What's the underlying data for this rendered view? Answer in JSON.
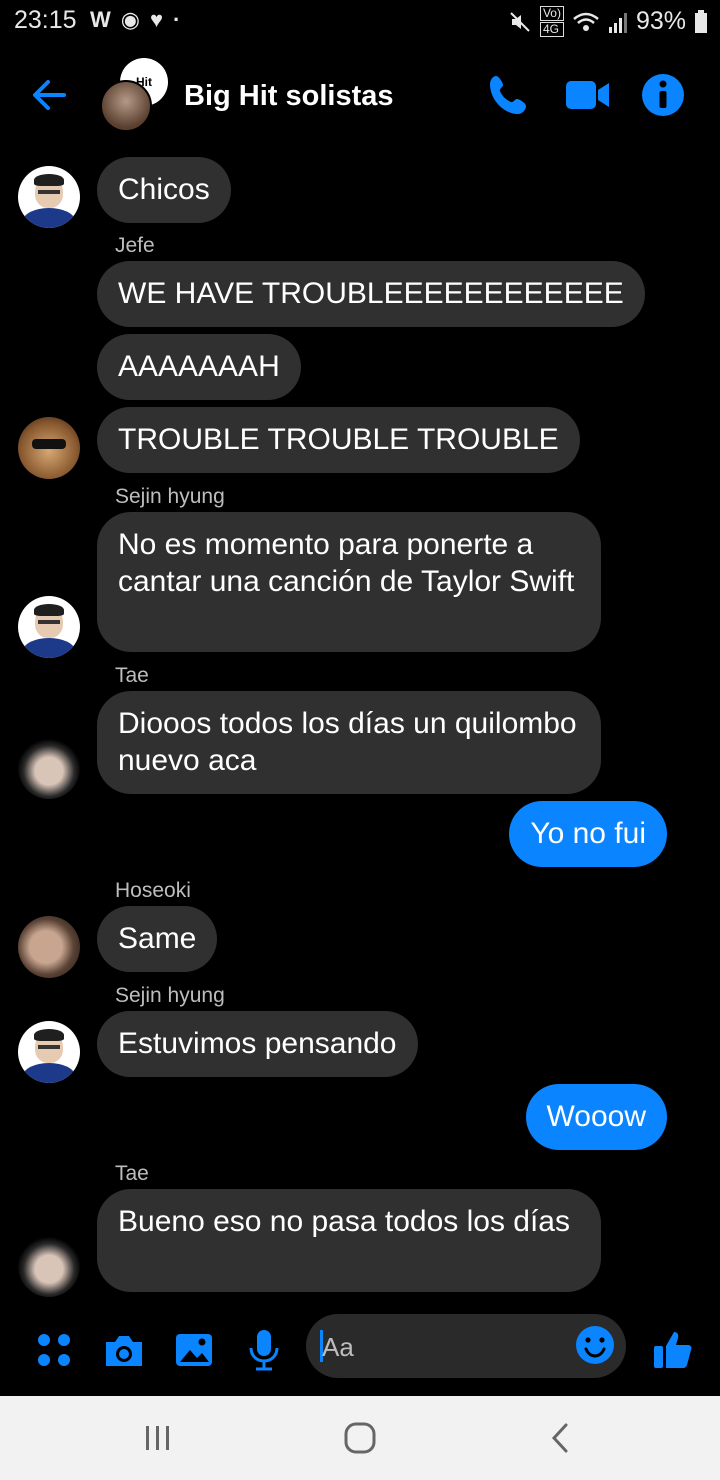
{
  "status_bar": {
    "time": "23:15",
    "left_icons": [
      "W",
      "◉",
      "♥",
      "·"
    ],
    "net_badge_1": "Vo)",
    "net_badge_2": "4G",
    "battery": "93%"
  },
  "header": {
    "title": "Big Hit solistas",
    "group_logo_text": "Hit"
  },
  "colors": {
    "accent": "#0a84ff",
    "bubble_other": "#303030",
    "background": "#000000"
  },
  "messages": [
    {
      "type": "other",
      "text": "Chicos"
    },
    {
      "type": "sender",
      "name": "Jefe"
    },
    {
      "type": "other",
      "text": "WE HAVE TROUBLEEEEEEEEEEEE"
    },
    {
      "type": "other",
      "text": "AAAAAAAH"
    },
    {
      "type": "other",
      "text": "TROUBLE TROUBLE TROUBLE"
    },
    {
      "type": "sender",
      "name": "Sejin hyung"
    },
    {
      "type": "other",
      "text": "No es momento para ponerte a cantar una canción de Taylor Swift"
    },
    {
      "type": "sender",
      "name": "Tae"
    },
    {
      "type": "other",
      "text": "Diooos todos los días un quilombo nuevo aca"
    },
    {
      "type": "mine",
      "text": "Yo no fui"
    },
    {
      "type": "sender",
      "name": "Hoseoki"
    },
    {
      "type": "other",
      "text": "Same"
    },
    {
      "type": "sender",
      "name": "Sejin hyung"
    },
    {
      "type": "other",
      "text": "Estuvimos pensando"
    },
    {
      "type": "mine",
      "text": "Wooow"
    },
    {
      "type": "sender",
      "name": "Tae"
    },
    {
      "type": "other",
      "text": "Bueno eso no pasa todos los días"
    }
  ],
  "composer": {
    "placeholder": "Aa",
    "icons": [
      "apps-icon",
      "camera-icon",
      "gallery-icon",
      "mic-icon",
      "emoji-icon",
      "like-icon"
    ]
  },
  "nav": {
    "icons": [
      "recent-apps-icon",
      "home-icon",
      "back-icon"
    ]
  }
}
